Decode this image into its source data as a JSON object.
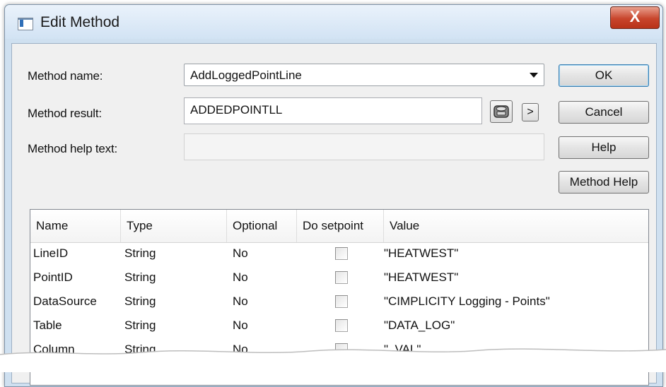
{
  "window": {
    "title": "Edit Method",
    "close_label": "X"
  },
  "form": {
    "method_name_label": "Method name:",
    "method_name_value": "AddLoggedPointLine",
    "method_result_label": "Method result:",
    "method_result_value": "ADDEDPOINTLL",
    "method_help_text_label": "Method help text:",
    "method_help_text_value": "",
    "more_label": ">"
  },
  "buttons": {
    "ok": "OK",
    "cancel": "Cancel",
    "help": "Help",
    "method_help": "Method Help"
  },
  "table": {
    "columns": [
      "Name",
      "Type",
      "Optional",
      "Do setpoint",
      "Value"
    ],
    "rows": [
      {
        "name": "LineID",
        "type": "String",
        "optional": "No",
        "do_setpoint": false,
        "value": "\"HEATWEST\""
      },
      {
        "name": "PointID",
        "type": "String",
        "optional": "No",
        "do_setpoint": false,
        "value": "\"HEATWEST\""
      },
      {
        "name": "DataSource",
        "type": "String",
        "optional": "No",
        "do_setpoint": false,
        "value": "\"CIMPLICITY Logging - Points\""
      },
      {
        "name": "Table",
        "type": "String",
        "optional": "No",
        "do_setpoint": false,
        "value": "\"DATA_LOG\""
      },
      {
        "name": "Column",
        "type": "String",
        "optional": "No",
        "do_setpoint": false,
        "value": "\"_VAL\""
      }
    ]
  },
  "colors": {
    "title_bar": "#d2e3f4",
    "dialog_face": "#f0f0f0",
    "close_button": "#c8452c",
    "default_button_border": "#3c7fb1"
  },
  "icons": {
    "title": "window-app-icon",
    "browse": "point-browser-icon"
  }
}
